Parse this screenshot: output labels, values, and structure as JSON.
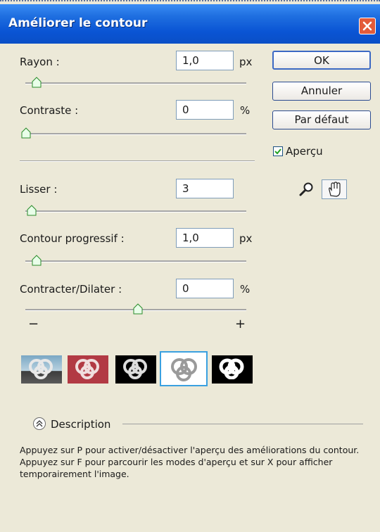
{
  "window": {
    "title": "Améliorer le contour"
  },
  "fields": [
    {
      "label": "Rayon :",
      "value": "1,0",
      "unit": "px",
      "slider_fraction": 0.05
    },
    {
      "label": "Contraste :",
      "value": "0",
      "unit": "%",
      "slider_fraction": 0.0
    },
    {
      "label": "Lisser :",
      "value": "3",
      "unit": "",
      "slider_fraction": 0.03
    },
    {
      "label": "Contour progressif :",
      "value": "1,0",
      "unit": "px",
      "slider_fraction": 0.05
    },
    {
      "label": "Contracter/Dilater :",
      "value": "0",
      "unit": "%",
      "slider_fraction": 0.5
    }
  ],
  "contract_expand": {
    "minus": "−",
    "plus": "+"
  },
  "buttons": {
    "ok": "OK",
    "cancel": "Annuler",
    "default": "Par défaut"
  },
  "preview": {
    "label": "Aperçu",
    "checked": true
  },
  "tools": {
    "zoom": "zoom-icon",
    "hand": "hand-icon"
  },
  "preview_modes": [
    {
      "name": "standard",
      "selected": false
    },
    {
      "name": "quick-mask",
      "selected": false
    },
    {
      "name": "on-black",
      "selected": false
    },
    {
      "name": "on-white",
      "selected": true
    },
    {
      "name": "mask",
      "selected": false
    }
  ],
  "description": {
    "label": "Description",
    "text": "Appuyez sur P pour activer/désactiver l'aperçu des améliorations du contour. Appuyez sur F pour parcourir les modes d'aperçu et sur X pour afficher temporairement l'image."
  },
  "colors": {
    "titlebar": "#0a54d4",
    "close": "#e35b3a",
    "selected_mode": "#3aa0e0"
  }
}
